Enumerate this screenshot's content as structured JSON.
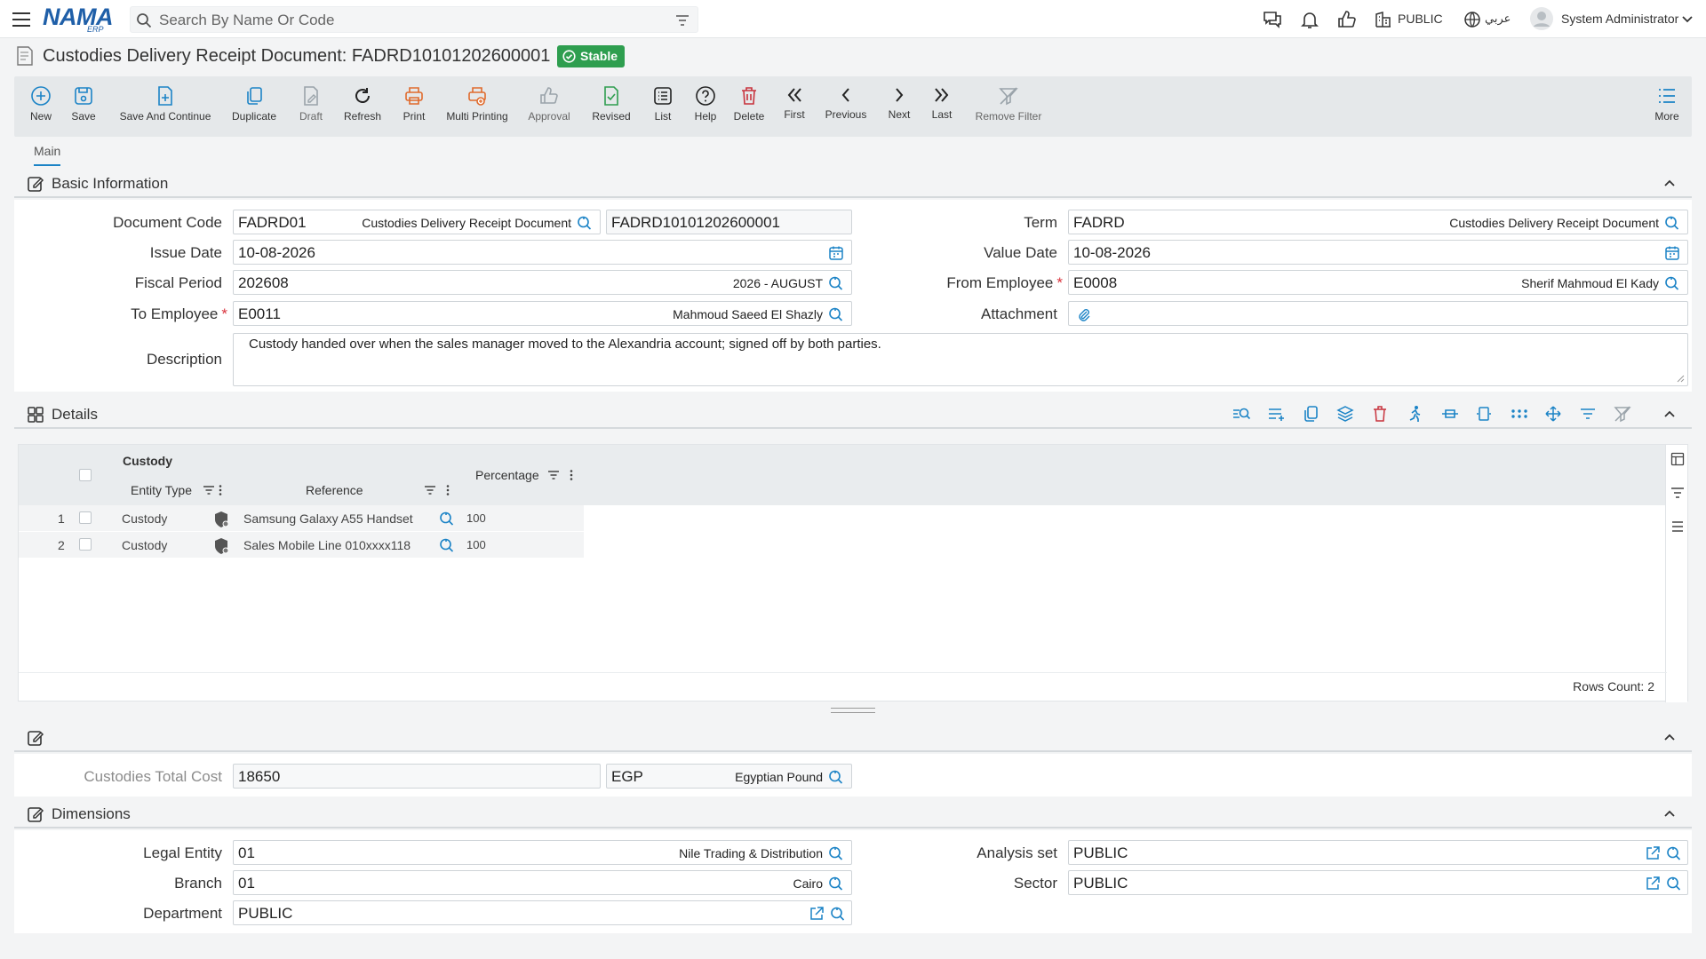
{
  "app": {
    "logo_text": "NAMA",
    "logo_sub": "ERP",
    "search_placeholder": "Search By Name Or Code",
    "public_label": "PUBLIC",
    "lang_label": "عربي",
    "user_name": "System Administrator"
  },
  "page": {
    "title": "Custodies Delivery Receipt Document: FADRD10101202600001",
    "status": "Stable"
  },
  "toolbar": {
    "new": "New",
    "save": "Save",
    "save_continue": "Save And Continue",
    "duplicate": "Duplicate",
    "draft": "Draft",
    "refresh": "Refresh",
    "print": "Print",
    "multi_printing": "Multi Printing",
    "approval": "Approval",
    "revised": "Revised",
    "list": "List",
    "help": "Help",
    "delete": "Delete",
    "first": "First",
    "previous": "Previous",
    "next": "Next",
    "last": "Last",
    "remove_filter": "Remove Filter",
    "more": "More"
  },
  "tabs": {
    "main": "Main"
  },
  "basic": {
    "title": "Basic Information",
    "document_code_label": "Document Code",
    "document_code": "FADRD01",
    "document_code_desc": "Custodies Delivery Receipt Document",
    "document_number": "FADRD10101202600001",
    "term_label": "Term",
    "term": "FADRD",
    "term_desc": "Custodies Delivery Receipt Document",
    "issue_date_label": "Issue Date",
    "issue_date": "10-08-2026",
    "value_date_label": "Value Date",
    "value_date": "10-08-2026",
    "fiscal_period_label": "Fiscal Period",
    "fiscal_period": "202608",
    "fiscal_period_desc": "2026 - AUGUST",
    "from_employee_label": "From Employee",
    "from_employee": "E0008",
    "from_employee_desc": "Sherif Mahmoud El Kady",
    "to_employee_label": "To Employee",
    "to_employee": "E0011",
    "to_employee_desc": "Mahmoud Saeed El Shazly",
    "attachment_label": "Attachment",
    "description_label": "Description",
    "description": "Custody handed over when the sales manager moved to the Alexandria account; signed off by both parties."
  },
  "details": {
    "title": "Details",
    "group_header": "Custody",
    "col_entity_type": "Entity Type",
    "col_reference": "Reference",
    "col_percentage": "Percentage",
    "rows": [
      {
        "num": "1",
        "entity_type": "Custody",
        "reference": "Samsung Galaxy A55 Handset",
        "percentage": "100"
      },
      {
        "num": "2",
        "entity_type": "Custody",
        "reference": "Sales Mobile Line 010xxxx118",
        "percentage": "100"
      }
    ],
    "rows_count": "Rows Count: 2"
  },
  "totals": {
    "cost_label": "Custodies Total Cost",
    "cost": "18650",
    "currency": "EGP",
    "currency_desc": "Egyptian Pound"
  },
  "dimensions": {
    "title": "Dimensions",
    "legal_entity_label": "Legal Entity",
    "legal_entity": "01",
    "legal_entity_desc": "Nile Trading & Distribution",
    "analysis_set_label": "Analysis set",
    "analysis_set": "PUBLIC",
    "branch_label": "Branch",
    "branch": "01",
    "branch_desc": "Cairo",
    "sector_label": "Sector",
    "sector": "PUBLIC",
    "department_label": "Department",
    "department": "PUBLIC"
  },
  "colors": {
    "primary": "#1b83c6",
    "stable_badge": "#2e9e4f",
    "orange": "#e06a2c",
    "danger": "#c8323c",
    "required": "#d9323c"
  }
}
